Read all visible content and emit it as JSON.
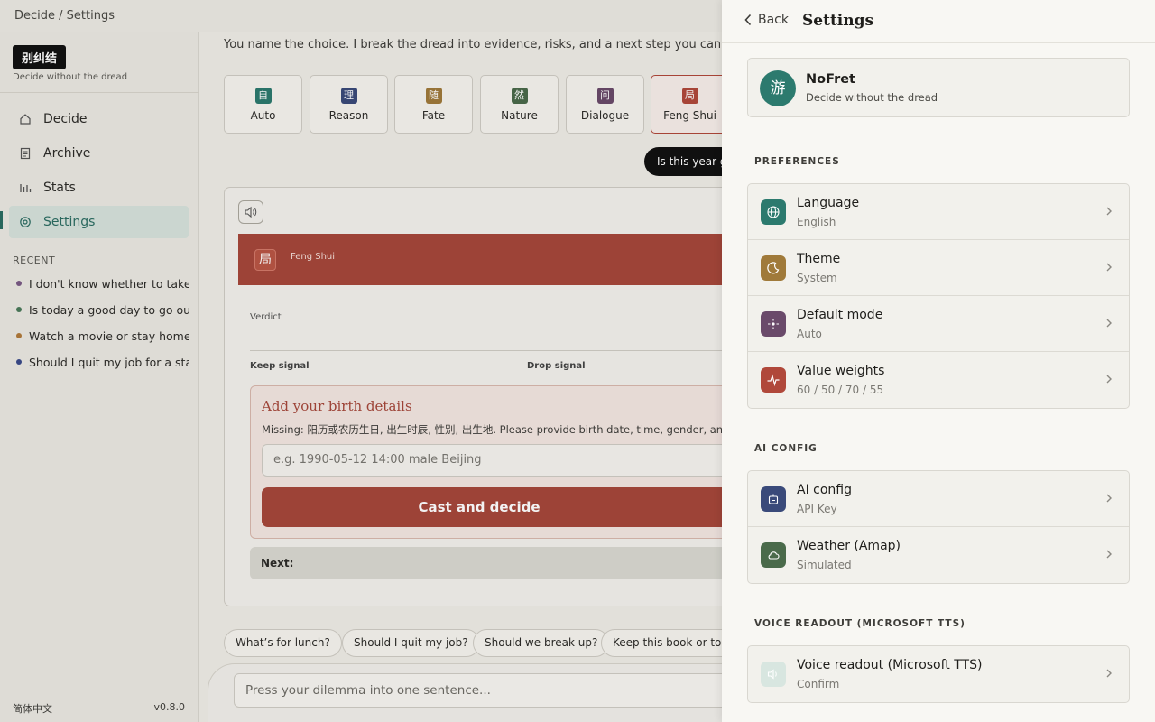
{
  "topbar": {
    "breadcrumb": "Decide / Settings"
  },
  "sidebar": {
    "brand": "别纠结",
    "tagline": "Decide without the dread",
    "nav": [
      {
        "label": "Decide",
        "icon": "home-icon"
      },
      {
        "label": "Archive",
        "icon": "document-icon"
      },
      {
        "label": "Stats",
        "icon": "bar-chart-icon"
      },
      {
        "label": "Settings",
        "icon": "gear-icon",
        "active": true
      }
    ],
    "recent_label": "RECENT",
    "recent": [
      {
        "text": "I don't know whether to take th",
        "color": "#7a5a85"
      },
      {
        "text": "Is today a good day to go out?",
        "color": "#4a7a5a"
      },
      {
        "text": "Watch a movie or stay home th",
        "color": "#b07a3a"
      },
      {
        "text": "Should I quit my job for a start",
        "color": "#3a4a8a"
      }
    ],
    "language": "简体中文",
    "version": "v0.8.0"
  },
  "main": {
    "intro": "You name the choice. I break the dread into evidence, risks, and a next step you can act on.",
    "modes": [
      {
        "glyph": "自",
        "label": "Auto",
        "color": "#2c7a6e"
      },
      {
        "glyph": "理",
        "label": "Reason",
        "color": "#3a4a7a"
      },
      {
        "glyph": "随",
        "label": "Fate",
        "color": "#a07a3a"
      },
      {
        "glyph": "然",
        "label": "Nature",
        "color": "#4a6a4a"
      },
      {
        "glyph": "问",
        "label": "Dialogue",
        "color": "#6a4a6a"
      },
      {
        "glyph": "局",
        "label": "Feng Shui",
        "color": "#b0483a",
        "active": true
      }
    ],
    "prompt_pill": "Is this year goo",
    "result": {
      "banner_glyph": "局",
      "banner_title": "Feng Shui",
      "verdict_label": "Verdict",
      "keep_label": "Keep signal",
      "drop_label": "Drop signal",
      "birth_title": "Add your birth details",
      "birth_missing": "Missing: 阳历或农历生日, 出生时辰, 性别, 出生地. Please provide birth date, time, gender, and birthp",
      "birth_placeholder": "e.g. 1990-05-12 14:00 male Beijing",
      "cast_button": "Cast and decide",
      "next_label": "Next:"
    },
    "chips": [
      "What’s for lunch?",
      "Should I quit my job?",
      "Should we break up?",
      "Keep this book or toss"
    ],
    "composer_placeholder": "Press your dilemma into one sentence..."
  },
  "drawer": {
    "back_label": "Back",
    "title": "Settings",
    "app": {
      "logo": "游",
      "name": "NoFret",
      "tagline": "Decide without the dread"
    },
    "sections": [
      {
        "label": "PREFERENCES",
        "rows": [
          {
            "title": "Language",
            "sub": "English",
            "icon": "globe-icon",
            "color": "#2c7a6e"
          },
          {
            "title": "Theme",
            "sub": "System",
            "icon": "moon-icon",
            "color": "#a07a3a"
          },
          {
            "title": "Default mode",
            "sub": "Auto",
            "icon": "sparkle-icon",
            "color": "#6a4a6a"
          },
          {
            "title": "Value weights",
            "sub": "60 / 50 / 70 / 55",
            "icon": "pulse-icon",
            "color": "#b0483a"
          }
        ]
      },
      {
        "label": "AI CONFIG",
        "rows": [
          {
            "title": "AI config",
            "sub": "API Key",
            "icon": "robot-icon",
            "color": "#3a4a7a"
          },
          {
            "title": "Weather (Amap)",
            "sub": "Simulated",
            "icon": "cloud-icon",
            "color": "#4a6a4a"
          }
        ]
      },
      {
        "label": "VOICE READOUT (MICROSOFT TTS)",
        "rows": [
          {
            "title": "Voice readout (Microsoft TTS)",
            "sub": "Confirm",
            "icon": "speaker-icon",
            "color": "#d8e6e0"
          }
        ]
      }
    ]
  }
}
